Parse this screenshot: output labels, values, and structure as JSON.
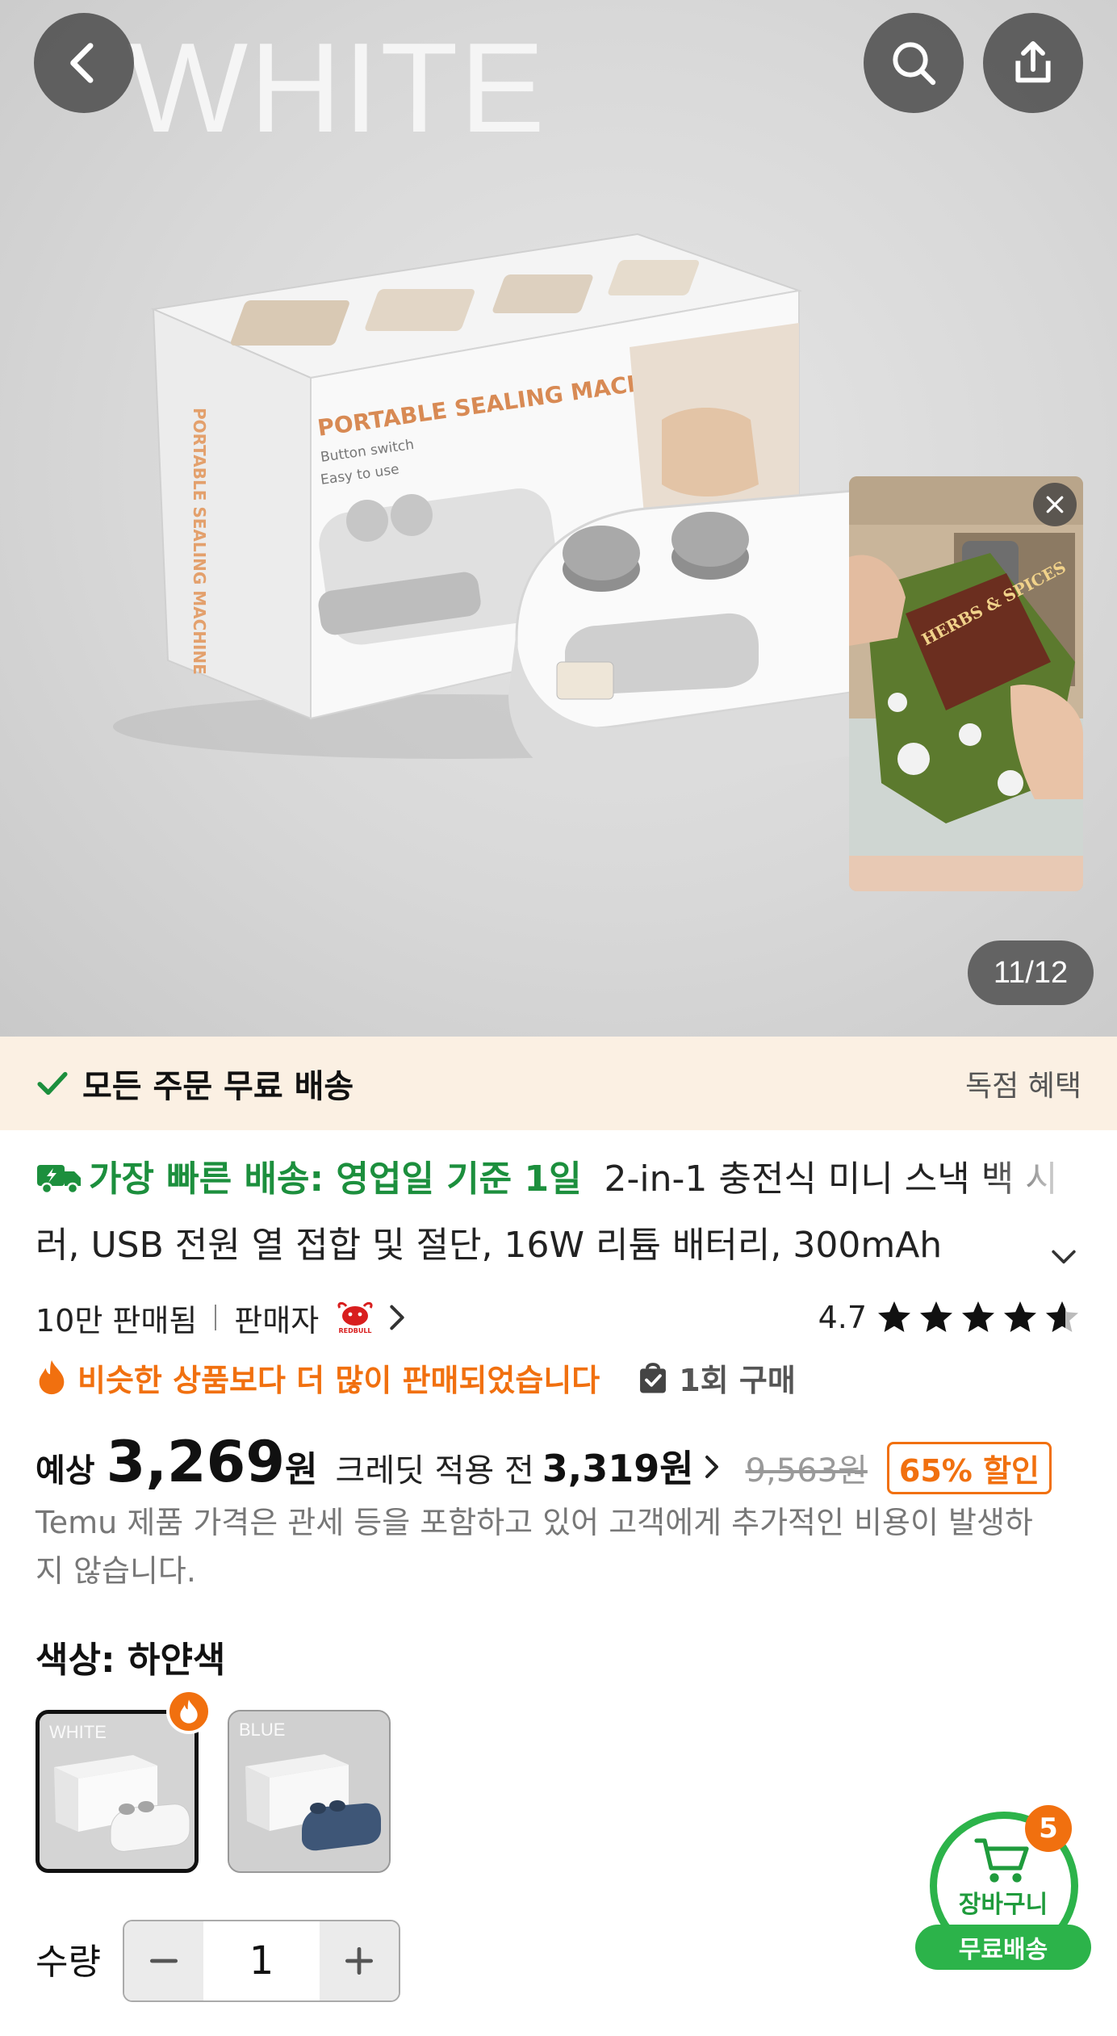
{
  "hero": {
    "watermark": "WHITE",
    "box_title": "PORTABLE SEALING MACHINE",
    "box_sub1": "Button switch",
    "box_sub2": "Easy to use",
    "box_side": "PORTABLE SEALING MACHINE",
    "pip_bag_text": "HERBS & SPICES",
    "counter": "11/12"
  },
  "banner": {
    "text": "모든 주문 무료 배송",
    "right": "독점 혜택"
  },
  "product": {
    "fast_delivery": "가장 빠른 배송: 영업일 기준 1일",
    "title": "2-in-1 충전식 미니 스낵 백 시러, USB 전원 열 접합 및 절단, 16W 리튬 배터리, 300mAh"
  },
  "meta": {
    "sales": "10만 판매됨",
    "seller_label": "판매자",
    "seller_logo_text": "REDBULL",
    "rating": "4.7",
    "rating_value": 4.7,
    "hot_text": "비슷한 상품보다 더 많이 판매되었습니다",
    "purchase": "1회 구매"
  },
  "price": {
    "label": "예상",
    "value": "3,269",
    "unit": "원",
    "credit_label": "크레딧 적용 전",
    "credit_price": "3,319원",
    "original": "9,563원",
    "discount": "65% 할인",
    "notice": "Temu 제품 가격은 관세 등을 포함하고 있어 고객에게 추가적인 비용이 발생하지 않습니다."
  },
  "color": {
    "label": "색상: 하얀색",
    "options": [
      {
        "tag": "WHITE",
        "body": "#f2f2f2"
      },
      {
        "tag": "BLUE",
        "body": "#3e5677"
      }
    ]
  },
  "quantity": {
    "label": "수량",
    "value": "1"
  },
  "cart": {
    "label": "장바구니",
    "count": "5",
    "shipping": "무료배송"
  },
  "colors": {
    "green": "#1c8f3d",
    "orange": "#f1700f",
    "banner_bg": "#fbf0e3"
  }
}
